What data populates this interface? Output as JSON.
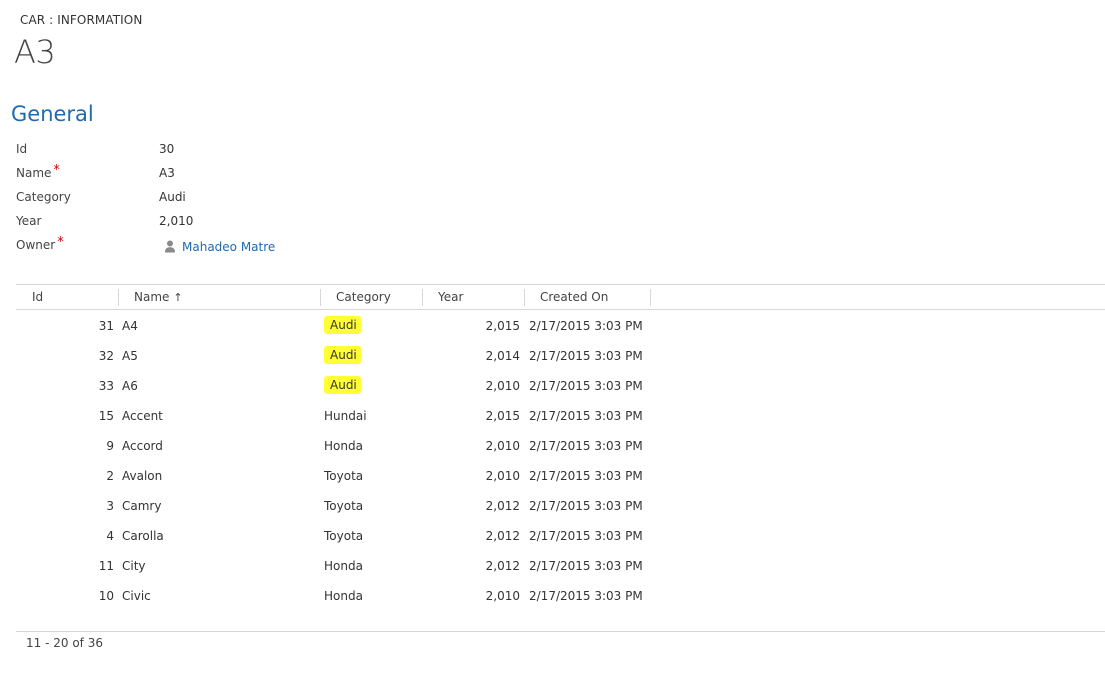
{
  "header": {
    "entity_label": "CAR : INFORMATION",
    "record_title": "A3"
  },
  "section": {
    "title": "General"
  },
  "form": {
    "id_label": "Id",
    "id_value": "30",
    "name_label": "Name",
    "name_value": "A3",
    "category_label": "Category",
    "category_value": "Audi",
    "year_label": "Year",
    "year_value": "2,010",
    "owner_label": "Owner",
    "owner_value": "Mahadeo Matre",
    "required_mark": "*"
  },
  "grid": {
    "columns": {
      "id": "Id",
      "name": "Name",
      "sort_arrow": "↑",
      "category": "Category",
      "year": "Year",
      "created_on": "Created On"
    },
    "rows": [
      {
        "id": "31",
        "name": "A4",
        "category": "Audi",
        "year": "2,015",
        "created_on": "2/17/2015 3:03 PM",
        "highlighted": true
      },
      {
        "id": "32",
        "name": "A5",
        "category": "Audi",
        "year": "2,014",
        "created_on": "2/17/2015 3:03 PM",
        "highlighted": true
      },
      {
        "id": "33",
        "name": "A6",
        "category": "Audi",
        "year": "2,010",
        "created_on": "2/17/2015 3:03 PM",
        "highlighted": true
      },
      {
        "id": "15",
        "name": "Accent",
        "category": "Hundai",
        "year": "2,015",
        "created_on": "2/17/2015 3:03 PM",
        "highlighted": false
      },
      {
        "id": "9",
        "name": "Accord",
        "category": "Honda",
        "year": "2,010",
        "created_on": "2/17/2015 3:03 PM",
        "highlighted": false
      },
      {
        "id": "2",
        "name": "Avalon",
        "category": "Toyota",
        "year": "2,010",
        "created_on": "2/17/2015 3:03 PM",
        "highlighted": false
      },
      {
        "id": "3",
        "name": "Camry",
        "category": "Toyota",
        "year": "2,012",
        "created_on": "2/17/2015 3:03 PM",
        "highlighted": false
      },
      {
        "id": "4",
        "name": "Carolla",
        "category": "Toyota",
        "year": "2,012",
        "created_on": "2/17/2015 3:03 PM",
        "highlighted": false
      },
      {
        "id": "11",
        "name": "City",
        "category": "Honda",
        "year": "2,012",
        "created_on": "2/17/2015 3:03 PM",
        "highlighted": false
      },
      {
        "id": "10",
        "name": "Civic",
        "category": "Honda",
        "year": "2,010",
        "created_on": "2/17/2015 3:03 PM",
        "highlighted": false
      }
    ],
    "pager": "11 - 20 of 36"
  },
  "colors": {
    "accent": "#1e6bb0",
    "required": "#cc0000",
    "highlight": "#ffff33"
  },
  "icons": {
    "owner": "person-icon",
    "sort": "arrow-up-icon"
  }
}
